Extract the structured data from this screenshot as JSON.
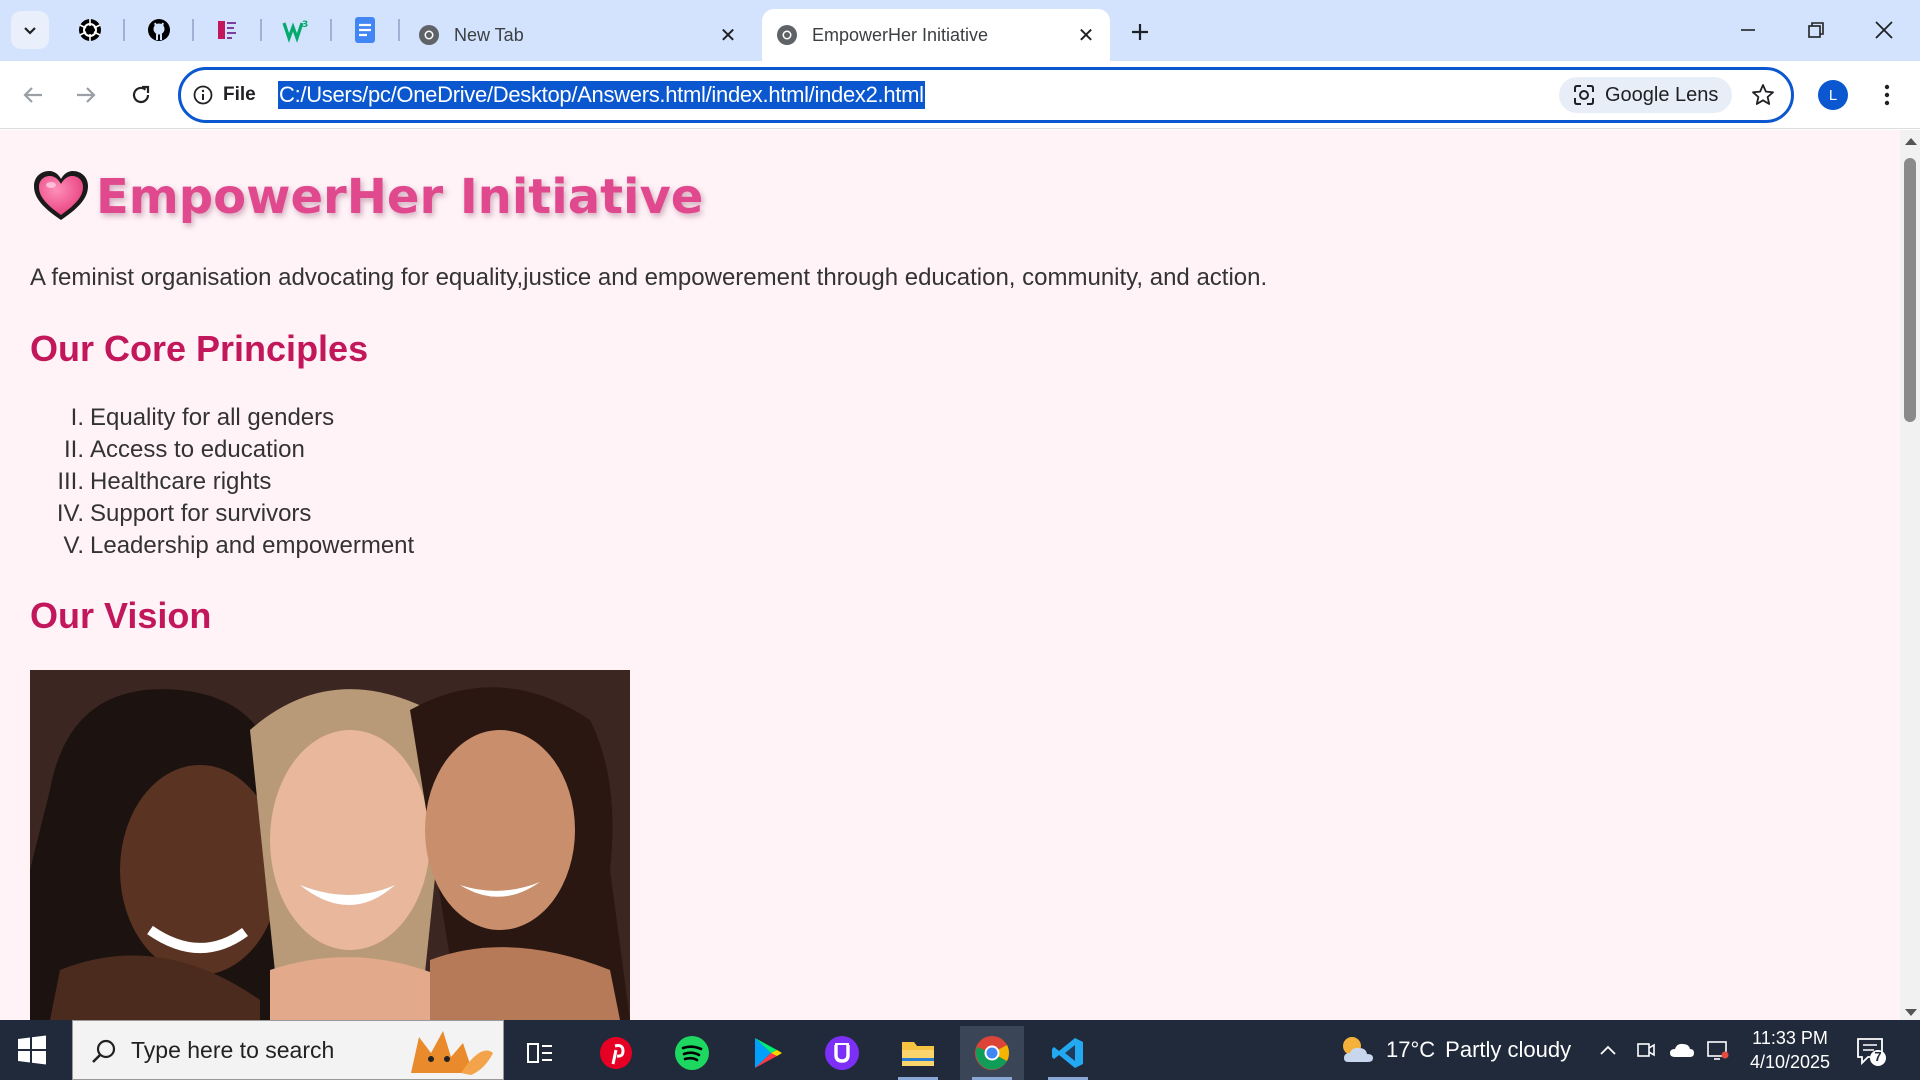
{
  "browser": {
    "tabs": [
      {
        "label": "New Tab",
        "icon": "chrome-icon"
      },
      {
        "label": "EmpowerHer Initiative",
        "icon": "globe-icon",
        "active": true
      }
    ],
    "pinned_tabs": [
      "openai-icon",
      "github-icon",
      "pdf-icon",
      "w3schools-icon",
      "docs-icon"
    ],
    "omnibox": {
      "scheme_label": "File",
      "url": "C:/Users/pc/OneDrive/Desktop/Answers.html/index.html/index2.html",
      "lens_label": "Google Lens"
    },
    "profile_initial": "L"
  },
  "page": {
    "title": "EmpowerHer Initiative",
    "tagline": "A feminist organisation advocating for equality,justice and empowerement through education, community, and action.",
    "principles_heading": "Our Core Principles",
    "principles": [
      {
        "num": "I.",
        "text": "Equality for all genders"
      },
      {
        "num": "II.",
        "text": "Access to education"
      },
      {
        "num": "III.",
        "text": "Healthcare rights"
      },
      {
        "num": "IV.",
        "text": "Support for survivors"
      },
      {
        "num": "V.",
        "text": "Leadership and empowerment"
      }
    ],
    "vision_heading": "Our Vision",
    "colors": {
      "background": "#fff3f7",
      "title": "#e0498d",
      "heading": "#c2185b"
    }
  },
  "taskbar": {
    "search_placeholder": "Type here to search",
    "weather": {
      "temp": "17°C",
      "condition": "Partly cloudy"
    },
    "time": "11:33 PM",
    "date": "4/10/2025",
    "notifications": "7",
    "apps": [
      "task-view-icon",
      "pinterest-icon",
      "spotify-icon",
      "google-play-icon",
      "u-app-icon",
      "file-explorer-icon",
      "chrome-icon",
      "vscode-icon"
    ]
  }
}
